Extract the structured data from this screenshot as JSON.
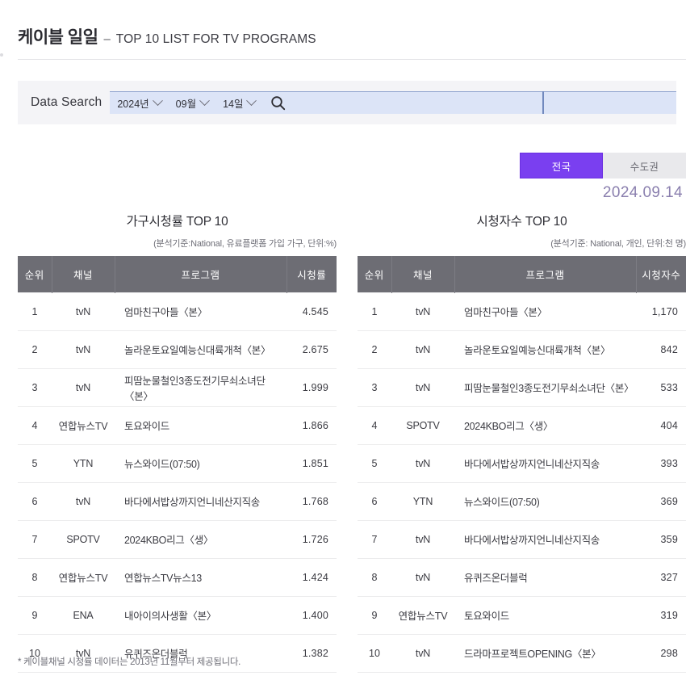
{
  "header": {
    "title_main": "케이블 일일",
    "title_dash": "–",
    "title_sub": "TOP 10 LIST FOR TV PROGRAMS"
  },
  "search": {
    "label": "Data Search",
    "year": "2024년",
    "month": "09월",
    "day": "14일",
    "search_icon": "search-icon"
  },
  "region_tabs": [
    {
      "label": "전국",
      "active": true
    },
    {
      "label": "수도권",
      "active": false
    }
  ],
  "date_stamp": "2024.09.14",
  "colors": {
    "accent_purple": "#7a3ff0",
    "value_purple": "#8176ab",
    "header_gray": "#6d6d74",
    "panel_gray": "#f4f4f7",
    "field_blue": "#dce4f7"
  },
  "footnote": "* 케이블채널 시청률 데이터는 2013년 11월부터 제공됩니다.",
  "tables": [
    {
      "title": "가구시청률 TOP 10",
      "subtitle": "(분석기준:National, 유료플랫폼 가입 가구, 단위:%)",
      "columns": [
        "순위",
        "채널",
        "프로그램",
        "시청률"
      ],
      "rows": [
        {
          "rank": "1",
          "channel": "tvN",
          "program": "엄마친구아들〈본〉",
          "value": "4.545"
        },
        {
          "rank": "2",
          "channel": "tvN",
          "program": "놀라운토요일예능신대륙개척〈본〉",
          "value": "2.675"
        },
        {
          "rank": "3",
          "channel": "tvN",
          "program": "피땀눈물철인3종도전기무쇠소녀단〈본〉",
          "value": "1.999"
        },
        {
          "rank": "4",
          "channel": "연합뉴스TV",
          "program": "토요와이드",
          "value": "1.866"
        },
        {
          "rank": "5",
          "channel": "YTN",
          "program": "뉴스와이드(07:50)",
          "value": "1.851"
        },
        {
          "rank": "6",
          "channel": "tvN",
          "program": "바다에서밥상까지언니네산지직송",
          "value": "1.768"
        },
        {
          "rank": "7",
          "channel": "SPOTV",
          "program": "2024KBO리그〈생〉",
          "value": "1.726"
        },
        {
          "rank": "8",
          "channel": "연합뉴스TV",
          "program": "연합뉴스TV뉴스13",
          "value": "1.424"
        },
        {
          "rank": "9",
          "channel": "ENA",
          "program": "내아이의사생활〈본〉",
          "value": "1.400"
        },
        {
          "rank": "10",
          "channel": "tvN",
          "program": "유퀴즈온더블럭",
          "value": "1.382"
        }
      ]
    },
    {
      "title": "시청자수 TOP 10",
      "subtitle": "(분석기준: National, 개인, 단위:천 명)",
      "columns": [
        "순위",
        "채널",
        "프로그램",
        "시청자수"
      ],
      "rows": [
        {
          "rank": "1",
          "channel": "tvN",
          "program": "엄마친구아들〈본〉",
          "value": "1,170"
        },
        {
          "rank": "2",
          "channel": "tvN",
          "program": "놀라운토요일예능신대륙개척〈본〉",
          "value": "842"
        },
        {
          "rank": "3",
          "channel": "tvN",
          "program": "피땀눈물철인3종도전기무쇠소녀단〈본〉",
          "value": "533"
        },
        {
          "rank": "4",
          "channel": "SPOTV",
          "program": "2024KBO리그〈생〉",
          "value": "404"
        },
        {
          "rank": "5",
          "channel": "tvN",
          "program": "바다에서밥상까지언니네산지직송",
          "value": "393"
        },
        {
          "rank": "6",
          "channel": "YTN",
          "program": "뉴스와이드(07:50)",
          "value": "369"
        },
        {
          "rank": "7",
          "channel": "tvN",
          "program": "바다에서밥상까지언니네산지직송",
          "value": "359"
        },
        {
          "rank": "8",
          "channel": "tvN",
          "program": "유퀴즈온더블럭",
          "value": "327"
        },
        {
          "rank": "9",
          "channel": "연합뉴스TV",
          "program": "토요와이드",
          "value": "319"
        },
        {
          "rank": "10",
          "channel": "tvN",
          "program": "드라마프로젝트OPENING〈본〉",
          "value": "298"
        }
      ]
    }
  ]
}
